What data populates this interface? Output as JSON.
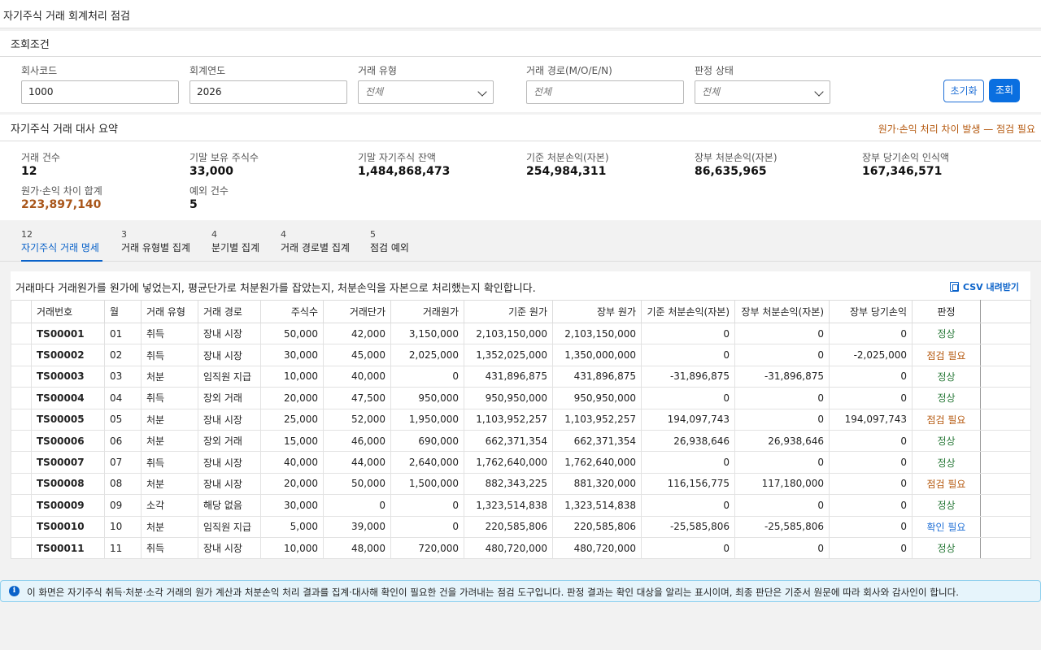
{
  "page": {
    "title": "자기주식 거래 회계처리 점검"
  },
  "filters": {
    "section_title": "조회조건",
    "company_code": {
      "label": "회사코드",
      "value": "1000"
    },
    "fiscal_year": {
      "label": "회계연도",
      "value": "2026"
    },
    "trade_type": {
      "label": "거래 유형",
      "value": "전체"
    },
    "trade_route": {
      "label": "거래 경로(M/O/E/N)",
      "placeholder": "전체"
    },
    "verdict_status": {
      "label": "판정 상태",
      "value": "전체"
    },
    "reset_label": "초기화",
    "search_label": "조회"
  },
  "summary": {
    "section_title": "자기주식 거래 대사 요약",
    "warning": "원가·손익 처리 차이 발생 — 점검 필요",
    "kpis": [
      {
        "label": "거래 건수",
        "value": "12"
      },
      {
        "label": "기말 보유 주식수",
        "value": "33,000"
      },
      {
        "label": "기말 자기주식 잔액",
        "value": "1,484,868,473"
      },
      {
        "label": "기준 처분손익(자본)",
        "value": "254,984,311"
      },
      {
        "label": "장부 처분손익(자본)",
        "value": "86,635,965"
      },
      {
        "label": "장부 당기손익 인식액",
        "value": "167,346,571"
      },
      {
        "label": "원가·손익 차이 합계",
        "value": "223,897,140"
      },
      {
        "label": "예외 건수",
        "value": "5"
      }
    ]
  },
  "tabs": [
    {
      "count": "12",
      "label": "자기주식 거래 명세"
    },
    {
      "count": "3",
      "label": "거래 유형별 집계"
    },
    {
      "count": "4",
      "label": "분기별 집계"
    },
    {
      "count": "4",
      "label": "거래 경로별 집계"
    },
    {
      "count": "5",
      "label": "점검 예외"
    }
  ],
  "table": {
    "description": "거래마다 거래원가를 원가에 넣었는지, 평균단가로 처분원가를 잡았는지, 처분손익을 자본으로 처리했는지 확인합니다.",
    "csv_label": "CSV 내려받기",
    "columns": [
      "거래번호",
      "월",
      "거래 유형",
      "거래 경로",
      "주식수",
      "거래단가",
      "거래원가",
      "기준 원가",
      "장부 원가",
      "기준 처분손익(자본)",
      "장부 처분손익(자본)",
      "장부 당기손익",
      "판정"
    ],
    "rows": [
      [
        "TS00001",
        "01",
        "취득",
        "장내 시장",
        "50,000",
        "42,000",
        "3,150,000",
        "2,103,150,000",
        "2,103,150,000",
        "0",
        "0",
        "0",
        "정상"
      ],
      [
        "TS00002",
        "02",
        "취득",
        "장내 시장",
        "30,000",
        "45,000",
        "2,025,000",
        "1,352,025,000",
        "1,350,000,000",
        "0",
        "0",
        "-2,025,000",
        "점검 필요"
      ],
      [
        "TS00003",
        "03",
        "처분",
        "임직원 지급",
        "10,000",
        "40,000",
        "0",
        "431,896,875",
        "431,896,875",
        "-31,896,875",
        "-31,896,875",
        "0",
        "정상"
      ],
      [
        "TS00004",
        "04",
        "취득",
        "장외 거래",
        "20,000",
        "47,500",
        "950,000",
        "950,950,000",
        "950,950,000",
        "0",
        "0",
        "0",
        "정상"
      ],
      [
        "TS00005",
        "05",
        "처분",
        "장내 시장",
        "25,000",
        "52,000",
        "1,950,000",
        "1,103,952,257",
        "1,103,952,257",
        "194,097,743",
        "0",
        "194,097,743",
        "점검 필요"
      ],
      [
        "TS00006",
        "06",
        "처분",
        "장외 거래",
        "15,000",
        "46,000",
        "690,000",
        "662,371,354",
        "662,371,354",
        "26,938,646",
        "26,938,646",
        "0",
        "정상"
      ],
      [
        "TS00007",
        "07",
        "취득",
        "장내 시장",
        "40,000",
        "44,000",
        "2,640,000",
        "1,762,640,000",
        "1,762,640,000",
        "0",
        "0",
        "0",
        "정상"
      ],
      [
        "TS00008",
        "08",
        "처분",
        "장내 시장",
        "20,000",
        "50,000",
        "1,500,000",
        "882,343,225",
        "881,320,000",
        "116,156,775",
        "117,180,000",
        "0",
        "점검 필요"
      ],
      [
        "TS00009",
        "09",
        "소각",
        "해당 없음",
        "30,000",
        "0",
        "0",
        "1,323,514,838",
        "1,323,514,838",
        "0",
        "0",
        "0",
        "정상"
      ],
      [
        "TS00010",
        "10",
        "처분",
        "임직원 지급",
        "5,000",
        "39,000",
        "0",
        "220,585,806",
        "220,585,806",
        "-25,585,806",
        "-25,585,806",
        "0",
        "확인 필요"
      ],
      [
        "TS00011",
        "11",
        "취득",
        "장내 시장",
        "10,000",
        "48,000",
        "720,000",
        "480,720,000",
        "480,720,000",
        "0",
        "0",
        "0",
        "정상"
      ]
    ]
  },
  "notice": {
    "icon": "info-icon",
    "text": "이 화면은 자기주식 취득·처분·소각 거래의 원가 계산과 처분손익 처리 결과를 집계·대사해 확인이 필요한 건을 가려내는 점검 도구입니다. 판정 결과는 확인 대상을 알리는 표시이며, 최종 판단은 기준서 원문에 따라 회사와 감사인이 합니다."
  },
  "colors": {
    "accent": "#0a6fe0",
    "warning": "#b5590f",
    "ok": "#2a7a3a",
    "confirm": "#1f6fd6"
  }
}
